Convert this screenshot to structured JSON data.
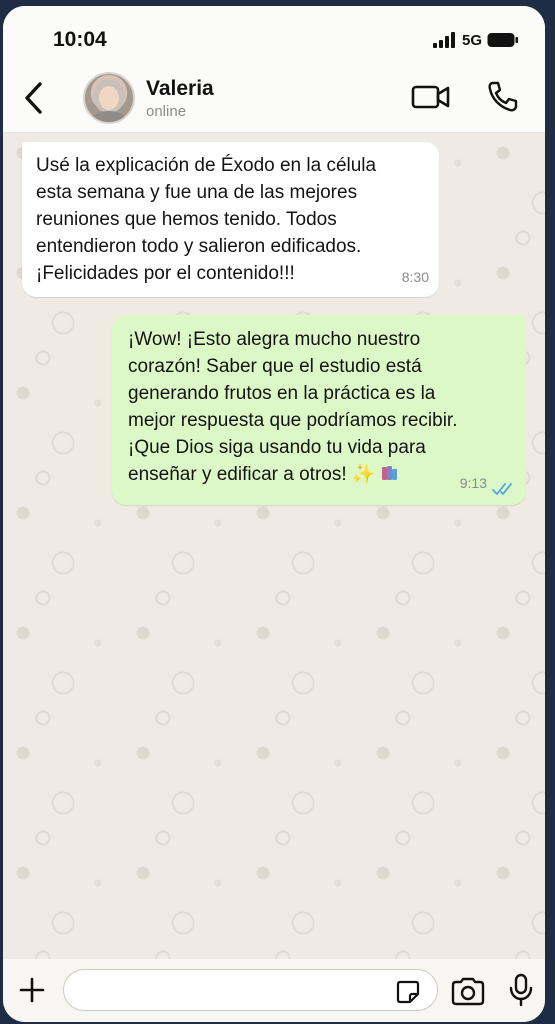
{
  "status_bar": {
    "time": "10:04",
    "network": "5G"
  },
  "header": {
    "contact_name": "Valeria",
    "contact_status": "online"
  },
  "icons": {
    "back": "chevron-left-icon",
    "video": "video-camera-icon",
    "call": "phone-icon",
    "plus": "plus-icon",
    "sticker": "sticker-icon",
    "camera": "camera-icon",
    "mic": "microphone-icon",
    "read_receipt": "double-check-icon"
  },
  "messages": [
    {
      "direction": "incoming",
      "text": "Usé la explicación de Éxodo en la célula\nesta semana y fue una de las mejores\nreuniones que hemos tenido. Todos\nentendieron todo y salieron edificados.\n¡Felicidades por el contenido!!!",
      "time": "8:30"
    },
    {
      "direction": "outgoing",
      "text": "¡Wow! ¡Esto alegra mucho nuestro\ncorazón! Saber que el estudio está\ngenerando frutos en la práctica es la\nmejor respuesta que podríamos recibir.\n¡Que Dios siga usando tu vida para\nenseñar y edificar a otros!",
      "emoji": "✨",
      "time": "9:13",
      "status": "read"
    }
  ],
  "composer": {
    "value": "",
    "placeholder": ""
  },
  "colors": {
    "outgoing_bubble": "#dcf8c6",
    "incoming_bubble": "#ffffff",
    "chat_background": "#efebe4",
    "read_tick": "#4fa6e8"
  }
}
